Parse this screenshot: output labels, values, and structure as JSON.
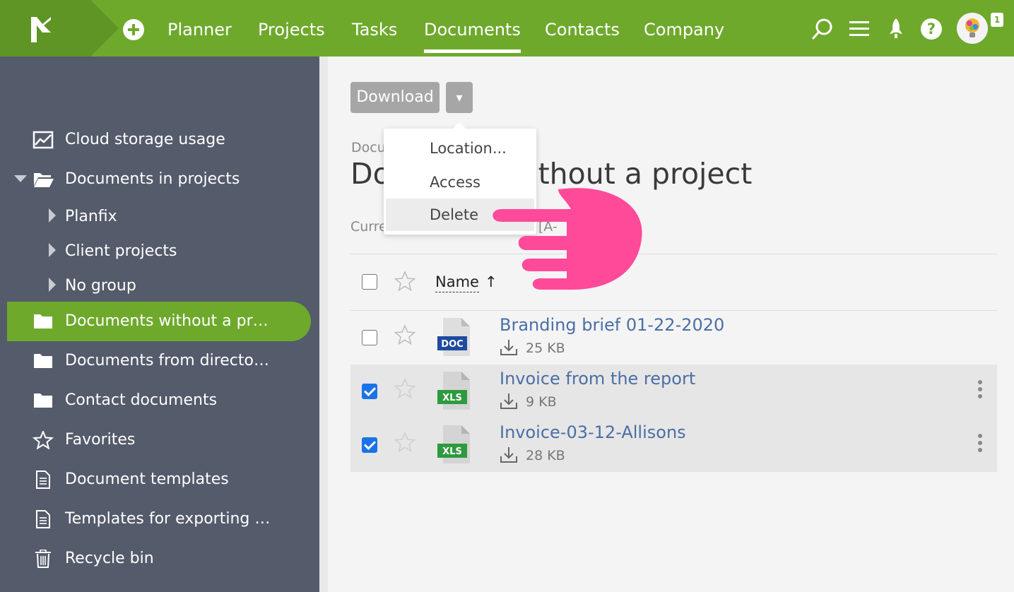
{
  "topbar": {
    "nav": [
      "Planner",
      "Projects",
      "Tasks",
      "Documents",
      "Contacts",
      "Company"
    ],
    "active": "Documents",
    "notifications": "1",
    "icons": [
      "logo-flag-icon",
      "add-icon",
      "search-icon",
      "menu-icon",
      "rocket-icon",
      "help-icon",
      "avatar"
    ]
  },
  "sidebar": {
    "items": [
      {
        "label": "Cloud storage usage",
        "icon": "chart-icon"
      },
      {
        "label": "Documents in projects",
        "icon": "folder-open-icon"
      },
      {
        "label": "Planfix",
        "icon": "chevron-right-icon"
      },
      {
        "label": "Client projects",
        "icon": "chevron-right-icon"
      },
      {
        "label": "No group",
        "icon": "chevron-right-icon"
      },
      {
        "label": "Documents without a pr…",
        "icon": "folder-icon"
      },
      {
        "label": "Documents from directo…",
        "icon": "folder-icon"
      },
      {
        "label": "Contact documents",
        "icon": "folder-icon"
      },
      {
        "label": "Favorites",
        "icon": "star-icon"
      },
      {
        "label": "Document templates",
        "icon": "document-icon"
      },
      {
        "label": "Templates for exporting …",
        "icon": "document-icon"
      },
      {
        "label": "Recycle bin",
        "icon": "trash-icon"
      }
    ]
  },
  "main": {
    "download_label": "Download",
    "more_label": "▾",
    "breadcrumb": "Docu",
    "title_left": "Do",
    "title_right": "without a project",
    "current_label": "Curre",
    "current_value": "[A-",
    "name_column": "Name",
    "sort_arrow": "↑",
    "files": [
      {
        "name": "Branding brief 01-22-2020",
        "size": "25 KB",
        "type": "DOC",
        "checked": false
      },
      {
        "name": "Invoice from the report",
        "size": "9 KB",
        "type": "XLS",
        "checked": true
      },
      {
        "name": "Invoice-03-12-Allisons",
        "size": "28 KB",
        "type": "XLS",
        "checked": true
      }
    ]
  },
  "dropdown": {
    "items": [
      "Location...",
      "Access",
      "Delete"
    ],
    "hovered": "Delete"
  },
  "colors": {
    "brand_green": "#6ea92c",
    "sidebar_bg": "#545b6b",
    "link_blue": "#4a6fa5",
    "doc_blue": "#1e4aa0",
    "xls_green": "#2e9a3e",
    "hand_pink": "#ff4a9a"
  }
}
